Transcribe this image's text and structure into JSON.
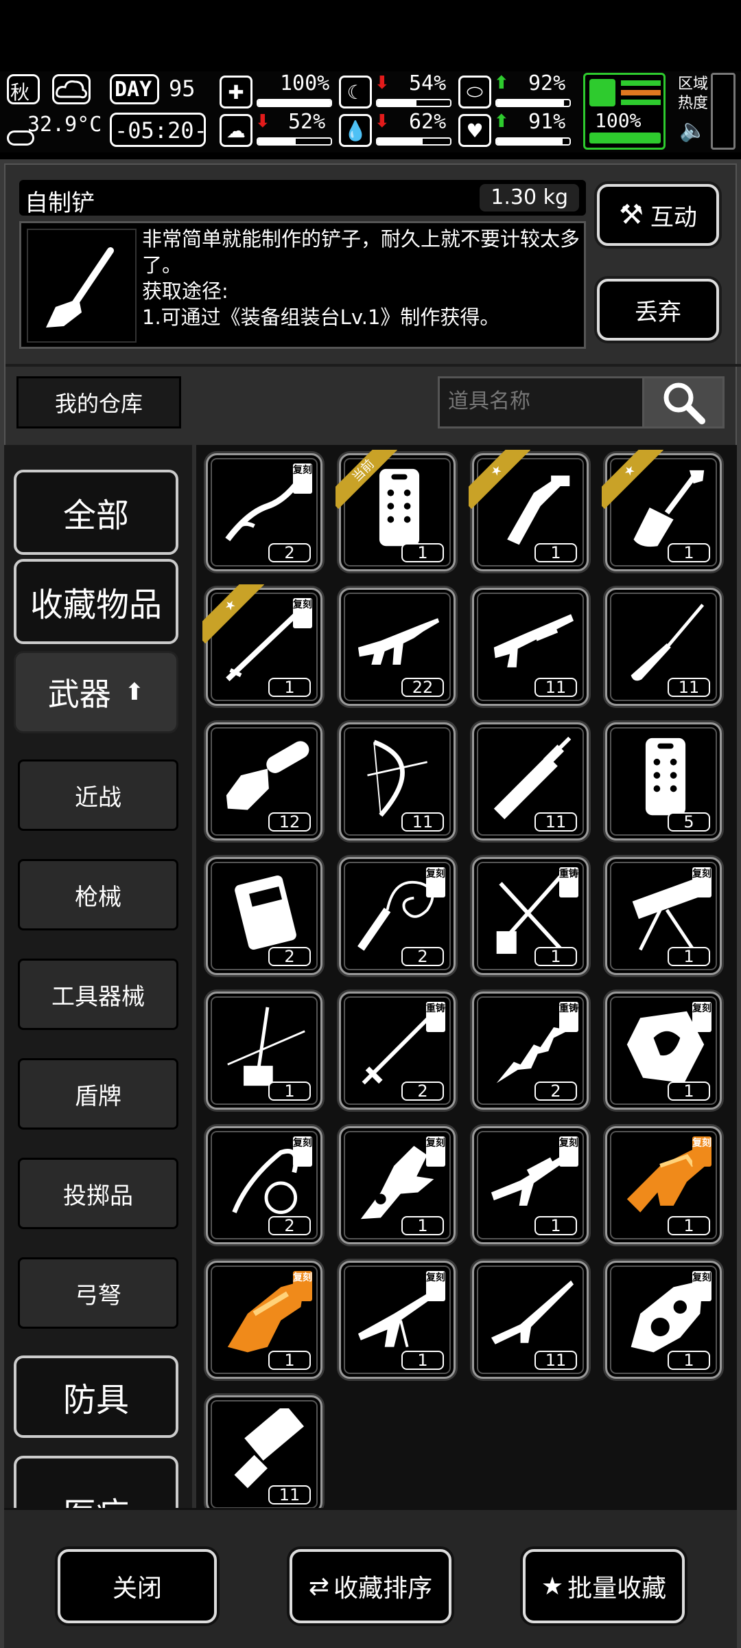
{
  "hud": {
    "season": "秋",
    "temperature": "32.9°C",
    "day_label": "DAY",
    "day": "95",
    "time": "-05:20-",
    "health_pct": "100%",
    "hunger_pct": "54%",
    "energy_pct": "92%",
    "mood_pct": "52%",
    "thirst_pct": "62%",
    "heart_pct": "91%",
    "stamina_pct": "100%",
    "region_label_1": "区域",
    "region_label_2": "热度"
  },
  "item": {
    "name": "自制铲",
    "weight": "1.30 kg",
    "description": "非常简单就能制作的铲子，耐久上就不要计较太多了。\n获取途径:\n1.可通过《装备组装台Lv.1》制作获得。",
    "interact_label": "互动",
    "discard_label": "丢弃"
  },
  "storage": {
    "label": "我的仓库",
    "search_placeholder": "道具名称"
  },
  "categories": {
    "all": "全部",
    "favorites": "收藏物品",
    "weapons": "武器",
    "armor": "防具",
    "medical": "医疗",
    "sub": [
      "近战",
      "枪械",
      "工具器械",
      "盾牌",
      "投掷品",
      "弓弩"
    ]
  },
  "tags": {
    "replica": "复刻",
    "reforge": "重铸",
    "current": "当前"
  },
  "items": [
    {
      "icon": "curved-sword-icon",
      "qty": "2",
      "tag": "replica"
    },
    {
      "icon": "riot-shield-icon",
      "qty": "1",
      "ribbon": "当前"
    },
    {
      "icon": "hatchet-knife-icon",
      "qty": "1",
      "ribbon": "star"
    },
    {
      "icon": "shovel-icon",
      "qty": "1",
      "ribbon": "star"
    },
    {
      "icon": "long-blade-icon",
      "qty": "1",
      "tag": "replica",
      "ribbon": "star"
    },
    {
      "icon": "assault-rifle-icon",
      "qty": "22"
    },
    {
      "icon": "shotgun-icon",
      "qty": "11"
    },
    {
      "icon": "screwdriver-icon",
      "qty": "11"
    },
    {
      "icon": "chainsaw-icon",
      "qty": "12"
    },
    {
      "icon": "compound-bow-icon",
      "qty": "11"
    },
    {
      "icon": "broadsword-icon",
      "qty": "11"
    },
    {
      "icon": "riot-shield-icon",
      "qty": "5"
    },
    {
      "icon": "crate-shield-icon",
      "qty": "2"
    },
    {
      "icon": "whip-icon",
      "qty": "2",
      "tag": "replica"
    },
    {
      "icon": "crossed-shovels-icon",
      "qty": "1",
      "tag": "reforge"
    },
    {
      "icon": "mounted-gun-icon",
      "qty": "1",
      "tag": "replica"
    },
    {
      "icon": "erhu-icon",
      "qty": "1"
    },
    {
      "icon": "katana-icon",
      "qty": "2",
      "tag": "reforge"
    },
    {
      "icon": "jagged-sword-icon",
      "qty": "2",
      "tag": "reforge"
    },
    {
      "icon": "dragon-shield-icon",
      "qty": "1",
      "tag": "replica"
    },
    {
      "icon": "scythe-chain-icon",
      "qty": "2",
      "tag": "replica"
    },
    {
      "icon": "dragon-blade-icon",
      "qty": "1",
      "tag": "replica"
    },
    {
      "icon": "sniper-rifle-icon",
      "qty": "1",
      "tag": "replica"
    },
    {
      "icon": "golden-cannon-icon",
      "qty": "1",
      "tag": "replica",
      "color": "#f08a1a"
    },
    {
      "icon": "golden-blaster-icon",
      "qty": "1",
      "tag": "replica",
      "color": "#f08a1a"
    },
    {
      "icon": "heavy-rifle-icon",
      "qty": "1",
      "tag": "replica"
    },
    {
      "icon": "rifle-icon",
      "qty": "11"
    },
    {
      "icon": "mecha-cannon-icon",
      "qty": "1",
      "tag": "replica"
    },
    {
      "icon": "minigun-icon",
      "qty": "11"
    }
  ],
  "footer": {
    "close_label": "关闭",
    "sort_label": "收藏排序",
    "batch_label": "批量收藏"
  },
  "colors": {
    "ribbon_gold": "#c9a227",
    "health_green": "#2ecb2e",
    "down_red": "#e21b1b"
  }
}
